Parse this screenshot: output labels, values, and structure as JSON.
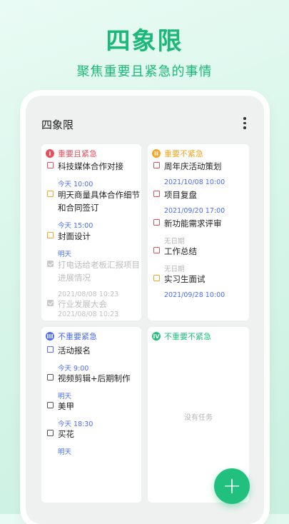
{
  "hero": {
    "title": "四象限",
    "subtitle": "聚焦重要且紧急的事情"
  },
  "app": {
    "title": "四象限",
    "more_icon": "more-vertical-icon"
  },
  "colors": {
    "q1": "#e8505b",
    "q2": "#f5a623",
    "q3": "#4a6cf7",
    "q4": "#22c07e",
    "date_blue": "#4a6cf7",
    "date_gray": "#b5b5b5",
    "done_gray": "#c0c0c0"
  },
  "quadrants": {
    "q1": {
      "badge": "I",
      "label": "重要且紧急",
      "tasks": [
        {
          "text": "科技媒体合作对接",
          "date": "今天 10:00"
        },
        {
          "text": "明天商量具体合作细节和合同签订",
          "date": "今天 15:00"
        },
        {
          "text": "封面设计",
          "date": "明天"
        },
        {
          "text": "打电话给老板汇报项目进展情况",
          "date": "2021/08/08 10:23"
        },
        {
          "text": "行业发展大会",
          "date": "2021/08/08 10:23"
        }
      ]
    },
    "q2": {
      "badge": "II",
      "label": "重要不紧急",
      "tasks": [
        {
          "text": "周年庆活动策划",
          "date": "2021/10/08 10:00"
        },
        {
          "text": "项目复盘",
          "date": "2021/09/20 17:00"
        },
        {
          "text": "新功能需求评审",
          "date": "无日期"
        },
        {
          "text": "工作总结",
          "date": "无日期"
        },
        {
          "text": "实习生面试",
          "date": "2021/09/28 10:00"
        }
      ]
    },
    "q3": {
      "badge": "III",
      "label": "不重要紧急",
      "tasks": [
        {
          "text": "活动报名",
          "date": "今天 9:00"
        },
        {
          "text": "视频剪辑+后期制作",
          "date": "明天"
        },
        {
          "text": "美甲",
          "date": "今天 18:30"
        },
        {
          "text": "买花",
          "date": "明天"
        }
      ]
    },
    "q4": {
      "badge": "IV",
      "label": "不重要不紧急",
      "empty_text": "没有任务"
    }
  },
  "fab": {
    "label": "+"
  }
}
